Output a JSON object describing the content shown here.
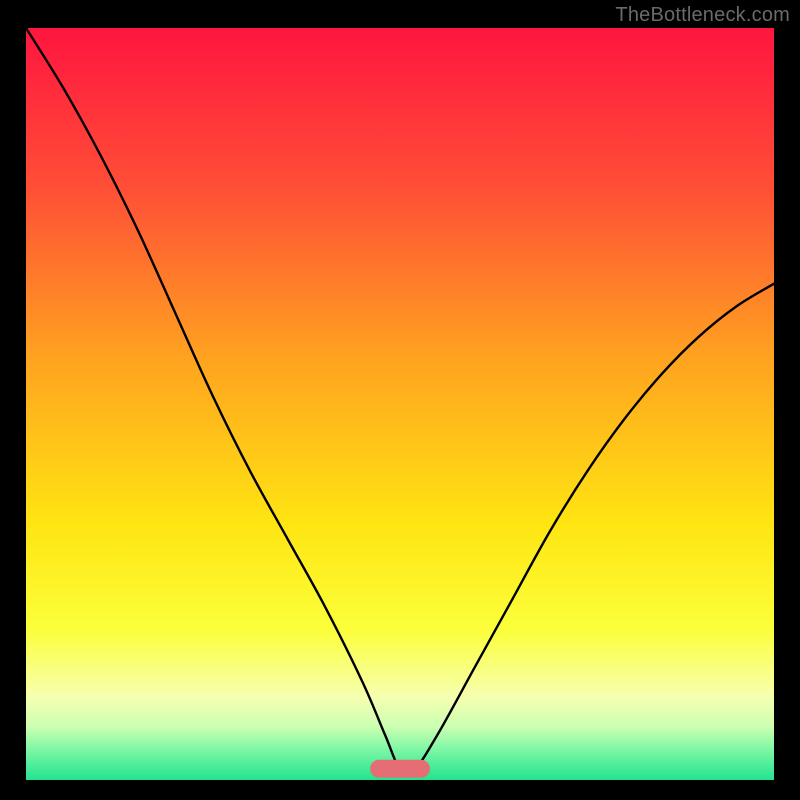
{
  "watermark": "TheBottleneck.com",
  "chart_data": {
    "type": "line",
    "title": "",
    "xlabel": "",
    "ylabel": "",
    "xlim": [
      0,
      100
    ],
    "ylim": [
      0,
      100
    ],
    "grid": false,
    "legend": false,
    "background": {
      "gradient_stops": [
        {
          "y_pct": 0,
          "color": "#ff153f"
        },
        {
          "y_pct": 22,
          "color": "#ff5136"
        },
        {
          "y_pct": 44,
          "color": "#ffa31f"
        },
        {
          "y_pct": 66,
          "color": "#ffe512"
        },
        {
          "y_pct": 80,
          "color": "#fbff3a"
        },
        {
          "y_pct": 89,
          "color": "#f6ffb0"
        },
        {
          "y_pct": 93,
          "color": "#caffb2"
        },
        {
          "y_pct": 96,
          "color": "#7cf7a5"
        },
        {
          "y_pct": 100,
          "color": "#22e38f"
        }
      ]
    },
    "series": [
      {
        "name": "bottleneck-curve",
        "color": "#000000",
        "x": [
          0,
          5,
          10,
          15,
          20,
          25,
          30,
          35,
          40,
          45,
          48,
          50,
          52,
          55,
          60,
          65,
          70,
          75,
          80,
          85,
          90,
          95,
          100
        ],
        "values": [
          100,
          92,
          83,
          73,
          62,
          51,
          41,
          32,
          23,
          13,
          6,
          1.5,
          1.5,
          6,
          15,
          24,
          33,
          41,
          48,
          54,
          59,
          63,
          66
        ]
      }
    ],
    "markers": [
      {
        "name": "optimal-zone",
        "shape": "pill",
        "color": "#e46e74",
        "x_center": 50,
        "y_value": 1.5,
        "half_width_x": 4,
        "half_height_y": 1.2
      }
    ]
  }
}
